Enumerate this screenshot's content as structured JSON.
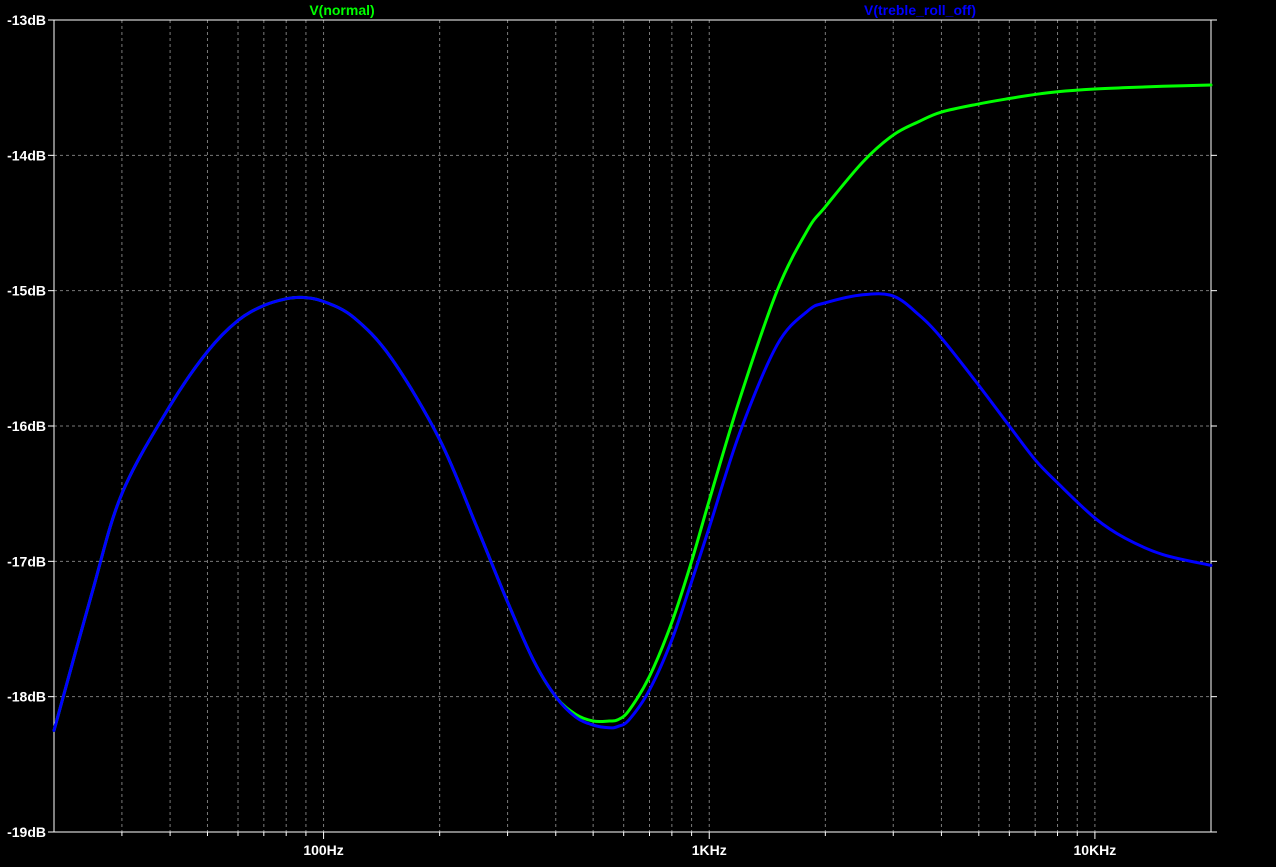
{
  "chart_data": {
    "type": "line",
    "title": "",
    "xlabel": "",
    "ylabel": "",
    "x_scale": "log",
    "x_unit": "Hz",
    "xlim": [
      20,
      20000
    ],
    "ylim": [
      -19,
      -13
    ],
    "grid": true,
    "x_tick_labels": [
      {
        "value": 100,
        "label": "100Hz"
      },
      {
        "value": 1000,
        "label": "1KHz"
      },
      {
        "value": 10000,
        "label": "10KHz"
      }
    ],
    "y_tick_labels": [
      {
        "value": -13,
        "label": "-13dB"
      },
      {
        "value": -14,
        "label": "-14dB"
      },
      {
        "value": -15,
        "label": "-15dB"
      },
      {
        "value": -16,
        "label": "-16dB"
      },
      {
        "value": -17,
        "label": "-17dB"
      },
      {
        "value": -18,
        "label": "-18dB"
      },
      {
        "value": -19,
        "label": "-19dB"
      }
    ],
    "series": [
      {
        "name": "V(normal)",
        "color": "#00ff00",
        "x": [
          20,
          25,
          30,
          40,
          50,
          60,
          70,
          80,
          88,
          100,
          120,
          150,
          200,
          250,
          300,
          350,
          400,
          450,
          500,
          550,
          580,
          620,
          700,
          800,
          900,
          1000,
          1200,
          1500,
          1800,
          2000,
          2500,
          3000,
          3500,
          4000,
          5000,
          6000,
          7000,
          8000,
          10000,
          12000,
          15000,
          20000
        ],
        "y": [
          -18.25,
          -17.25,
          -16.5,
          -15.85,
          -15.45,
          -15.22,
          -15.11,
          -15.06,
          -15.05,
          -15.08,
          -15.2,
          -15.5,
          -16.1,
          -16.75,
          -17.3,
          -17.73,
          -18.0,
          -18.13,
          -18.18,
          -18.18,
          -18.17,
          -18.1,
          -17.85,
          -17.45,
          -17.0,
          -16.55,
          -15.8,
          -15.0,
          -14.55,
          -14.38,
          -14.05,
          -13.85,
          -13.75,
          -13.68,
          -13.62,
          -13.58,
          -13.55,
          -13.53,
          -13.51,
          -13.5,
          -13.49,
          -13.48
        ]
      },
      {
        "name": "V(treble_roll_off)",
        "color": "#0000ff",
        "x": [
          20,
          25,
          30,
          40,
          50,
          60,
          70,
          80,
          88,
          100,
          120,
          150,
          200,
          250,
          300,
          350,
          400,
          450,
          500,
          550,
          580,
          620,
          700,
          800,
          900,
          1000,
          1200,
          1500,
          1800,
          2000,
          2500,
          3000,
          3500,
          4000,
          5000,
          6000,
          7000,
          8000,
          10000,
          12000,
          15000,
          20000
        ],
        "y": [
          -18.25,
          -17.25,
          -16.5,
          -15.85,
          -15.45,
          -15.22,
          -15.11,
          -15.06,
          -15.05,
          -15.08,
          -15.2,
          -15.5,
          -16.1,
          -16.75,
          -17.3,
          -17.73,
          -18.0,
          -18.15,
          -18.21,
          -18.23,
          -18.22,
          -18.17,
          -17.95,
          -17.58,
          -17.15,
          -16.75,
          -16.05,
          -15.4,
          -15.15,
          -15.09,
          -15.03,
          -15.04,
          -15.18,
          -15.35,
          -15.7,
          -16.0,
          -16.25,
          -16.42,
          -16.68,
          -16.83,
          -16.95,
          -17.03
        ]
      }
    ]
  }
}
